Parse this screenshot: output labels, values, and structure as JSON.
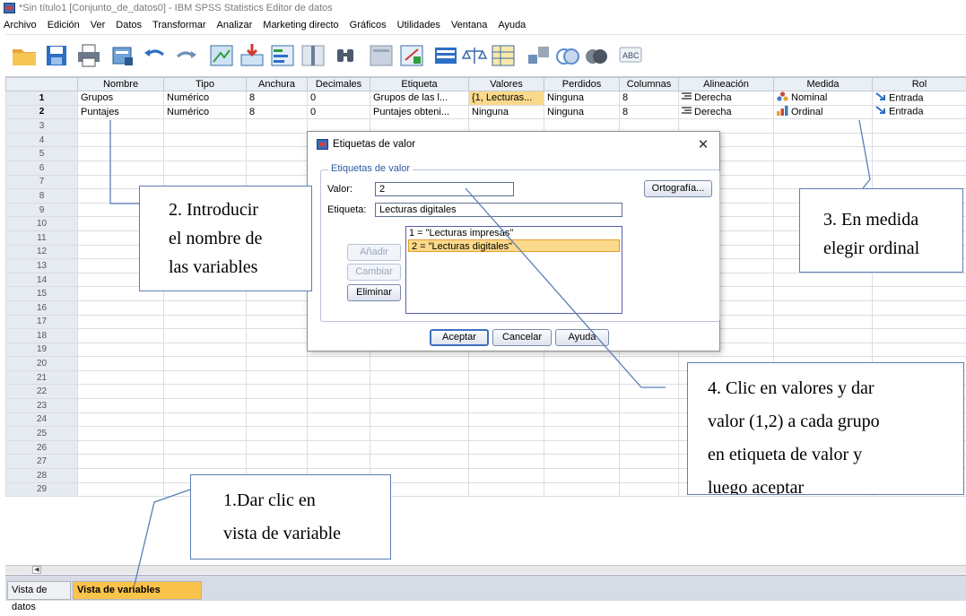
{
  "window": {
    "title": "*Sin título1 [Conjunto_de_datos0] - IBM SPSS Statistics Editor de datos"
  },
  "menu": [
    "Archivo",
    "Edición",
    "Ver",
    "Datos",
    "Transformar",
    "Analizar",
    "Marketing directo",
    "Gráficos",
    "Utilidades",
    "Ventana",
    "Ayuda"
  ],
  "grid": {
    "columns": [
      "",
      "Nombre",
      "Tipo",
      "Anchura",
      "Decimales",
      "Etiqueta",
      "Valores",
      "Perdidos",
      "Columnas",
      "Alineación",
      "Medida",
      "Rol"
    ],
    "rows": [
      {
        "num": "1",
        "nombre": "Grupos",
        "tipo": "Numérico",
        "anchura": "8",
        "decimales": "0",
        "etiqueta": "Grupos de las l...",
        "valores": "{1, Lecturas...",
        "perdidos": "Ninguna",
        "columnas": "8",
        "alineacion": "Derecha",
        "medida": "Nominal",
        "rol": "Entrada"
      },
      {
        "num": "2",
        "nombre": "Puntajes",
        "tipo": "Numérico",
        "anchura": "8",
        "decimales": "0",
        "etiqueta": "Puntajes obteni...",
        "valores": "Ninguna",
        "perdidos": "Ninguna",
        "columnas": "8",
        "alineacion": "Derecha",
        "medida": "Ordinal",
        "rol": "Entrada"
      }
    ],
    "empty_row_numbers": [
      "3",
      "4",
      "5",
      "6",
      "7",
      "8",
      "9",
      "10",
      "11",
      "12",
      "13",
      "14",
      "15",
      "16",
      "17",
      "18",
      "19",
      "20",
      "21",
      "22",
      "23",
      "24",
      "25",
      "26",
      "27",
      "28",
      "29"
    ]
  },
  "tabs": {
    "datos": "Vista de datos",
    "variables": "Vista de variables"
  },
  "dialog": {
    "title": "Etiquetas de valor",
    "group_label": "Etiquetas de valor",
    "valor_label": "Valor:",
    "valor_value": "2",
    "etiqueta_label": "Etiqueta:",
    "etiqueta_value": "Lecturas digitales",
    "ortografia": "Ortografía...",
    "anadir": "Añadir",
    "cambiar": "Cambiar",
    "eliminar": "Eliminar",
    "list": [
      "1 = \"Lecturas impresas\"",
      "2 = \"Lecturas digitales\""
    ],
    "aceptar": "Aceptar",
    "cancelar": "Cancelar",
    "ayuda": "Ayuda"
  },
  "callouts": {
    "c1": [
      "1.Dar clic en",
      "vista de variable"
    ],
    "c2": [
      "2. Introducir",
      "el nombre de",
      "las variables"
    ],
    "c3": [
      "3. En medida",
      "elegir ordinal"
    ],
    "c4": [
      "4. Clic en valores y dar",
      "valor (1,2) a cada grupo",
      "en etiqueta de valor y",
      "luego aceptar"
    ]
  },
  "colors": {
    "accent": "#fbc34a",
    "selected_cell": "#fbd98a",
    "callout_border": "#5a7fb5"
  }
}
